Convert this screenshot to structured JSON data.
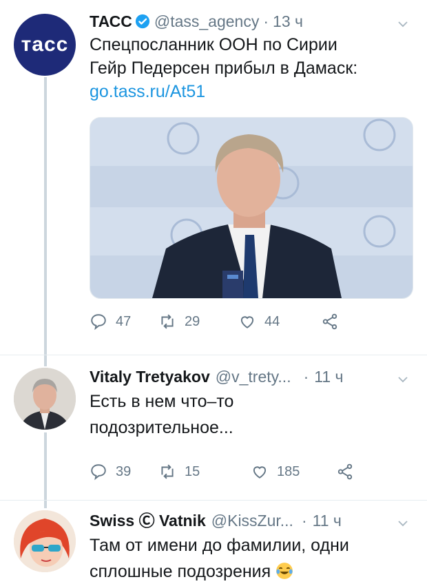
{
  "tweets": [
    {
      "name": "ТАСС",
      "handle": "@tass_agency",
      "dot": "·",
      "time": "13 ч",
      "text_line1": "Спецпосланник ООН по Сирии",
      "text_line2": "Гейр Педерсен прибыл в Дамаск:",
      "link": "go.tass.ru/At51",
      "avatar_text": "тасс",
      "stats": {
        "replies": "47",
        "retweets": "29",
        "likes": "44"
      }
    },
    {
      "name": "Vitaly Tretyakov",
      "handle": "@v_trety...",
      "dot": "·",
      "time": "11 ч",
      "text_line1": "Есть в нем что–то",
      "text_line2": "подозрительное...",
      "stats": {
        "replies": "39",
        "retweets": "15",
        "likes": "185"
      }
    },
    {
      "name": "Swiss Ⓒ Vatnik",
      "handle": "@KissZur...",
      "dot": "·",
      "time": "11 ч",
      "text_line1": "Там от имени до фамилии, одни",
      "text_line2": "сплошные подозрения"
    }
  ],
  "colors": {
    "link": "#1b95e0",
    "secondary": "#657786",
    "verified": "#1da1f2",
    "tass_blue": "#1e2a78"
  },
  "icons": [
    "reply-icon",
    "retweet-icon",
    "like-icon",
    "share-icon",
    "chevron-down-icon",
    "verified-badge-icon",
    "laughing-emoji"
  ]
}
